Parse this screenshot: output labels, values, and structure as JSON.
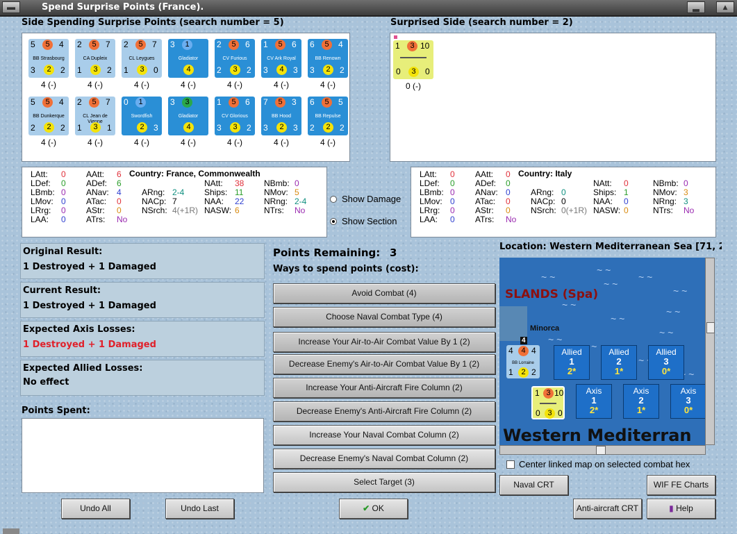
{
  "window": {
    "title": "Spend Surprise Points (France)."
  },
  "left_panel": {
    "header": "Side Spending Surprise Points (search number = 5)",
    "counters": [
      {
        "tl": "5",
        "tc": "5",
        "tr": "4",
        "name": "BB Strasbourg",
        "bl": "3",
        "bc": "2",
        "br": "2",
        "cap": "4 (-)",
        "style": "light"
      },
      {
        "tl": "2",
        "tc": "5",
        "tr": "7",
        "name": "CA Dupleix",
        "bl": "1",
        "bc": "3",
        "br": "2",
        "cap": "4 (-)",
        "style": "light"
      },
      {
        "tl": "2",
        "tc": "5",
        "tr": "7",
        "name": "CL Leygues",
        "bl": "1",
        "bc": "3",
        "br": "0",
        "cap": "4 (-)",
        "style": "light"
      },
      {
        "tl": "3",
        "tc": "1",
        "tr": "",
        "name": "Gladiator",
        "bl": "",
        "bc": "4",
        "br": "",
        "cap": "4 (-)",
        "style": "dark"
      },
      {
        "tl": "2",
        "tc": "5",
        "tr": "6",
        "name": "CV Furious",
        "bl": "2",
        "bc": "3",
        "br": "2",
        "cap": "4 (-)",
        "style": "dark"
      },
      {
        "tl": "1",
        "tc": "5",
        "tr": "6",
        "name": "CV Ark Royal",
        "bl": "3",
        "bc": "4",
        "br": "3",
        "cap": "4 (-)",
        "style": "dark"
      },
      {
        "tl": "6",
        "tc": "5",
        "tr": "4",
        "name": "BB Renown",
        "bl": "3",
        "bc": "2",
        "br": "2",
        "cap": "4 (-)",
        "style": "dark"
      },
      {
        "tl": "5",
        "tc": "5",
        "tr": "4",
        "name": "BB Dunkerque",
        "bl": "2",
        "bc": "2",
        "br": "2",
        "cap": "4 (-)",
        "style": "light"
      },
      {
        "tl": "2",
        "tc": "5",
        "tr": "7",
        "name": "CL Jean de Vienne",
        "bl": "1",
        "bc": "3",
        "br": "1",
        "cap": "4 (-)",
        "style": "light"
      },
      {
        "tl": "0",
        "tc": "1",
        "tr": "",
        "name": "Swordfish",
        "bl": "",
        "bc": "2",
        "br": "3",
        "cap": "4 (-)",
        "style": "dark"
      },
      {
        "tl": "3",
        "tc": "3",
        "tr": "",
        "name": "Gladiator",
        "bl": "",
        "bc": "4",
        "br": "",
        "cap": "4 (-)",
        "style": "dark"
      },
      {
        "tl": "1",
        "tc": "5",
        "tr": "6",
        "name": "CV Glorious",
        "bl": "3",
        "bc": "3",
        "br": "2",
        "cap": "4 (-)",
        "style": "dark"
      },
      {
        "tl": "7",
        "tc": "5",
        "tr": "3",
        "name": "BB Hood",
        "bl": "3",
        "bc": "2",
        "br": "3",
        "cap": "4 (-)",
        "style": "dark"
      },
      {
        "tl": "6",
        "tc": "5",
        "tr": "5",
        "name": "BB Repulse",
        "bl": "2",
        "bc": "2",
        "br": "2",
        "cap": "4 (-)",
        "style": "dark"
      }
    ],
    "stats": {
      "latt": "0",
      "ldef": "0",
      "lbmb": "0",
      "lmov": "0",
      "lrrg": "0",
      "laa": "0",
      "aatt": "6",
      "adef": "6",
      "anav": "4",
      "atac": "0",
      "astr": "0",
      "atrs": "No",
      "country": "Country: France, Commonwealth",
      "arng": "2-4",
      "nacp": "7",
      "nsrch": "4(+1R)",
      "natt": "38",
      "ships": "11",
      "naa": "22",
      "nasw": "6",
      "nbmb": "0",
      "nmov": "5",
      "nrng": "2-4",
      "ntrs": "No"
    }
  },
  "right_panel": {
    "header": "Surprised Side (search number = 2)",
    "counter": {
      "tl": "1",
      "tc": "3",
      "tr": "10",
      "bl": "0",
      "bc": "3",
      "br": "0",
      "cap": "0 (-)"
    },
    "stats": {
      "latt": "0",
      "ldef": "0",
      "lbmb": "0",
      "lmov": "0",
      "lrrg": "0",
      "laa": "0",
      "aatt": "0",
      "adef": "0",
      "anav": "0",
      "atac": "0",
      "astr": "0",
      "atrs": "No",
      "country": "Country: Italy",
      "arng": "0",
      "nacp": "0",
      "nsrch": "0(+1R)",
      "natt": "0",
      "ships": "1",
      "naa": "0",
      "nasw": "0",
      "nbmb": "0",
      "nmov": "3",
      "nrng": "3",
      "ntrs": "No"
    }
  },
  "labels": {
    "latt": "LAtt:",
    "ldef": "LDef:",
    "lbmb": "LBmb:",
    "lmov": "LMov:",
    "lrrg": "LRrg:",
    "laa": "LAA:",
    "aatt": "AAtt:",
    "adef": "ADef:",
    "anav": "ANav:",
    "atac": "ATac:",
    "astr": "AStr:",
    "atrs": "ATrs:",
    "arng": "ARng:",
    "nacp": "NACp:",
    "nsrch": "NSrch:",
    "natt": "NAtt:",
    "ships": "Ships:",
    "naa": "NAA:",
    "nasw": "NASW:",
    "nbmb": "NBmb:",
    "nmov": "NMov:",
    "nrng": "NRng:",
    "ntrs": "NTrs:"
  },
  "view_options": {
    "show_damage": "Show Damage",
    "show_section": "Show Section",
    "selected": "show_section"
  },
  "results": {
    "original": {
      "label": "Original Result:",
      "value": "1 Destroyed + 1 Damaged"
    },
    "current": {
      "label": "Current Result:",
      "value": "1 Destroyed + 1 Damaged"
    },
    "axis_losses": {
      "label": "Expected Axis Losses:",
      "value": "1 Destroyed + 1 Damaged"
    },
    "allied_losses": {
      "label": "Expected Allied Losses:",
      "value": "No effect"
    },
    "points_spent": {
      "label": "Points Spent:"
    }
  },
  "points": {
    "label": "Points Remaining:",
    "value": "3",
    "ways": "Ways to spend points (cost):"
  },
  "spend_options": [
    "Avoid Combat (4)",
    "Choose Naval Combat Type (4)",
    "Increase Your Air-to-Air Combat Value By 1 (2)",
    "Decrease Enemy's Air-to-Air Combat Value By 1 (2)",
    "Increase Your Anti-Aircraft Fire Column (2)",
    "Decrease Enemy's Anti-Aircraft Fire Column (2)",
    "Increase Your Naval Combat Column (2)",
    "Decrease Enemy's Naval Combat Column (2)",
    "Select Target (3)"
  ],
  "location": {
    "label": "Location: Western Mediterranean Sea [71, 2"
  },
  "map": {
    "region_label": "SLANDS (Spa)",
    "minorca": "Minorca",
    "sea_label": "Western Mediterran",
    "my_counter": {
      "tl": "4",
      "tc": "4",
      "tr": "4",
      "name": "BB Lorraine",
      "bl": "1",
      "bc": "2",
      "br": "2"
    },
    "allied_boxes": [
      {
        "t": "Allied",
        "n": "1",
        "s": "2*"
      },
      {
        "t": "Allied",
        "n": "2",
        "s": "1*"
      },
      {
        "t": "Allied",
        "n": "3",
        "s": "0*"
      }
    ],
    "axis_boxes": [
      {
        "t": "Axis",
        "n": "1",
        "s": "2*"
      },
      {
        "t": "Axis",
        "n": "2",
        "s": "1*"
      },
      {
        "t": "Axis",
        "n": "3",
        "s": "0*"
      }
    ],
    "enemy_counter": {
      "tl": "1",
      "tc": "3",
      "tr": "10",
      "bl": "0",
      "bc": "3",
      "br": "0"
    }
  },
  "center_map_label": "Center linked map on selected combat hex",
  "buttons": {
    "naval_crt": "Naval CRT",
    "wif_charts": "WIF FE Charts",
    "aa_crt": "Anti-aircraft CRT",
    "help": "Help",
    "undo_all": "Undo All",
    "undo_last": "Undo Last",
    "ok": "OK"
  },
  "colors": {
    "light_counter": "#a9cdea",
    "dark_counter": "#2a8fd6",
    "yellow_counter": "#e7ee7a",
    "orange_dot": "#f07038",
    "yellow_dot": "#f4e30a",
    "red_text": "#e0202a"
  }
}
